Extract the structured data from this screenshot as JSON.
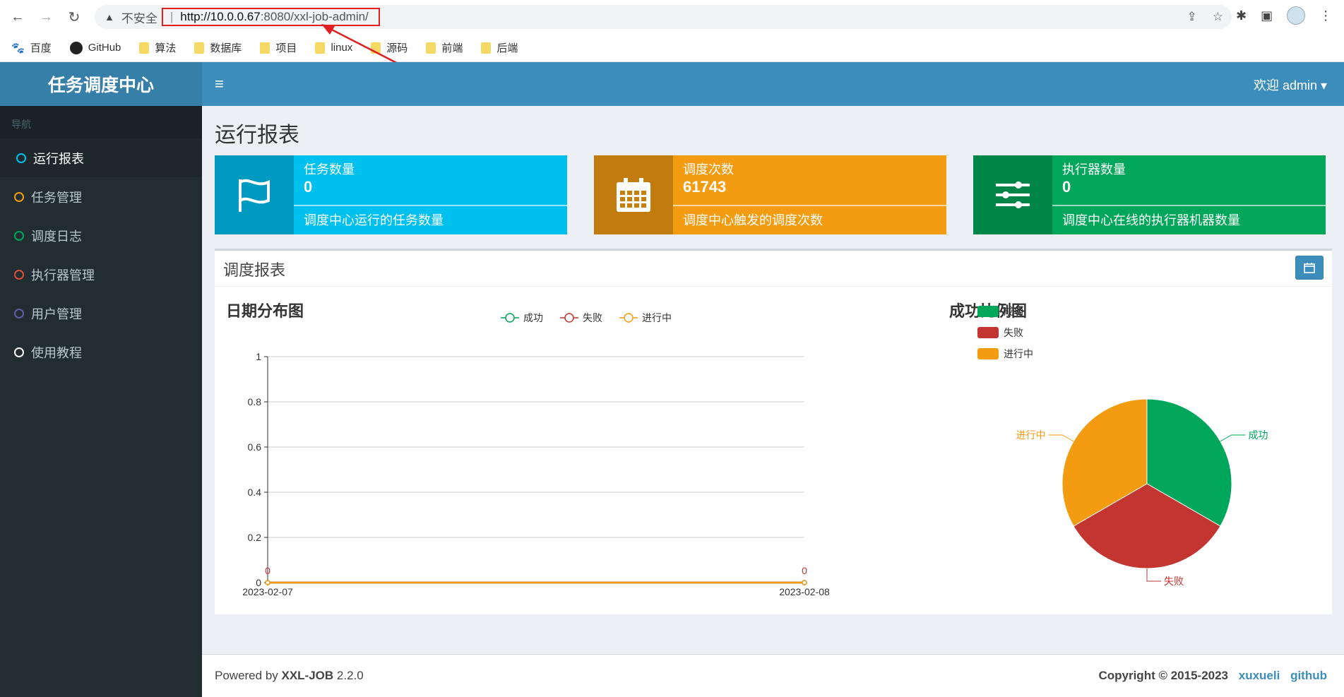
{
  "browser": {
    "insecure_label": "不安全",
    "url_separator": "|",
    "url_host": "http://10.0.0.67",
    "url_path": ":8080/xxl-job-admin/",
    "bookmarks": [
      {
        "label": "百度",
        "icon": "baidu-paw-icon"
      },
      {
        "label": "GitHub",
        "icon": "github-icon"
      },
      {
        "label": "算法",
        "icon": "folder-icon"
      },
      {
        "label": "数据库",
        "icon": "folder-icon"
      },
      {
        "label": "项目",
        "icon": "folder-icon"
      },
      {
        "label": "linux",
        "icon": "folder-icon"
      },
      {
        "label": "源码",
        "icon": "folder-icon"
      },
      {
        "label": "前端",
        "icon": "folder-icon"
      },
      {
        "label": "后端",
        "icon": "folder-icon"
      }
    ]
  },
  "sidebar": {
    "logo": "任务调度中心",
    "nav_header": "导航",
    "items": [
      {
        "label": "运行报表",
        "color": "#00c0ef"
      },
      {
        "label": "任务管理",
        "color": "#f39c12"
      },
      {
        "label": "调度日志",
        "color": "#00a65a"
      },
      {
        "label": "执行器管理",
        "color": "#dd4b39"
      },
      {
        "label": "用户管理",
        "color": "#605ca8"
      },
      {
        "label": "使用教程",
        "color": "#ffffff"
      }
    ]
  },
  "topbar": {
    "welcome": "欢迎 admin ▾"
  },
  "page": {
    "title": "运行报表"
  },
  "info_boxes": [
    {
      "title": "任务数量",
      "number": "0",
      "desc": "调度中心运行的任务数量",
      "color": "#00c0ef",
      "icon": "flag-icon"
    },
    {
      "title": "调度次数",
      "number": "61743",
      "desc": "调度中心触发的调度次数",
      "color": "#f39c12",
      "icon": "calendar-icon"
    },
    {
      "title": "执行器数量",
      "number": "0",
      "desc": "调度中心在线的执行器机器数量",
      "color": "#00a65a",
      "icon": "sliders-icon"
    }
  ],
  "report": {
    "box_title": "调度报表",
    "line_chart_title": "日期分布图",
    "pie_chart_title": "成功比例图"
  },
  "chart_data": [
    {
      "type": "line",
      "title": "日期分布图",
      "x": [
        "2023-02-07",
        "2023-02-08"
      ],
      "series": [
        {
          "name": "成功",
          "values": [
            0,
            0
          ],
          "color": "#00a65a"
        },
        {
          "name": "失败",
          "values": [
            0,
            0
          ],
          "color": "#c23531"
        },
        {
          "name": "进行中",
          "values": [
            0,
            0
          ],
          "color": "#f39c12"
        }
      ],
      "ylim": [
        0,
        1
      ],
      "yticks": [
        "0",
        "0.2",
        "0.4",
        "0.6",
        "0.8",
        "1"
      ],
      "data_labels": [
        "0",
        "0"
      ],
      "legend": "top-center"
    },
    {
      "type": "pie",
      "title": "成功比例图",
      "slices": [
        {
          "name": "成功",
          "value": 1,
          "color": "#00a65a"
        },
        {
          "name": "失败",
          "value": 1,
          "color": "#c23531"
        },
        {
          "name": "进行中",
          "value": 1,
          "color": "#f39c12"
        }
      ],
      "legend": "top-left"
    }
  ],
  "footer": {
    "powered_prefix": "Powered by ",
    "product": "XXL-JOB",
    "version": " 2.2.0",
    "copyright": "Copyright © 2015-2023",
    "link_author": "xuxueli",
    "link_github": "github"
  }
}
